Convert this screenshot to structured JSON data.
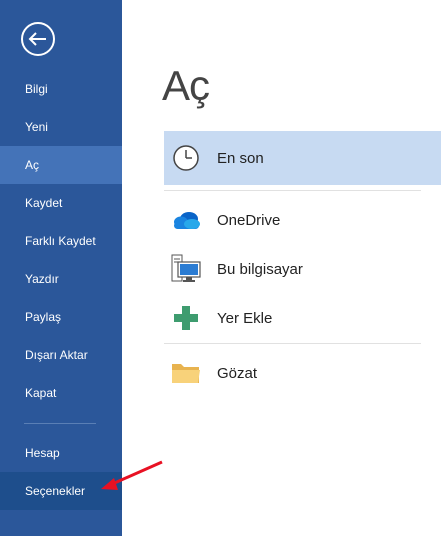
{
  "sidebar": {
    "back_label": "",
    "items": [
      {
        "label": "Bilgi"
      },
      {
        "label": "Yeni"
      },
      {
        "label": "Aç"
      },
      {
        "label": "Kaydet"
      },
      {
        "label": "Farklı Kaydet"
      },
      {
        "label": "Yazdır"
      },
      {
        "label": "Paylaş"
      },
      {
        "label": "Dışarı Aktar"
      },
      {
        "label": "Kapat"
      }
    ],
    "bottom_items": [
      {
        "label": "Hesap"
      },
      {
        "label": "Seçenekler"
      }
    ],
    "active_item": "Aç",
    "colors": {
      "background": "#2b579a",
      "active": "#4473b8",
      "text": "#ffffff"
    }
  },
  "main": {
    "title": "Aç",
    "locations": [
      {
        "label": "En son",
        "icon": "clock-icon"
      },
      {
        "label": "OneDrive",
        "icon": "onedrive-cloud-icon"
      },
      {
        "label": "Bu bilgisayar",
        "icon": "computer-icon"
      },
      {
        "label": "Yer Ekle",
        "icon": "plus-icon"
      },
      {
        "label": "Gözat",
        "icon": "folder-icon"
      }
    ],
    "colors": {
      "selected": "#c7daf2"
    }
  },
  "annotation": {
    "icon": "red-arrow-icon",
    "color": "#e81123"
  }
}
